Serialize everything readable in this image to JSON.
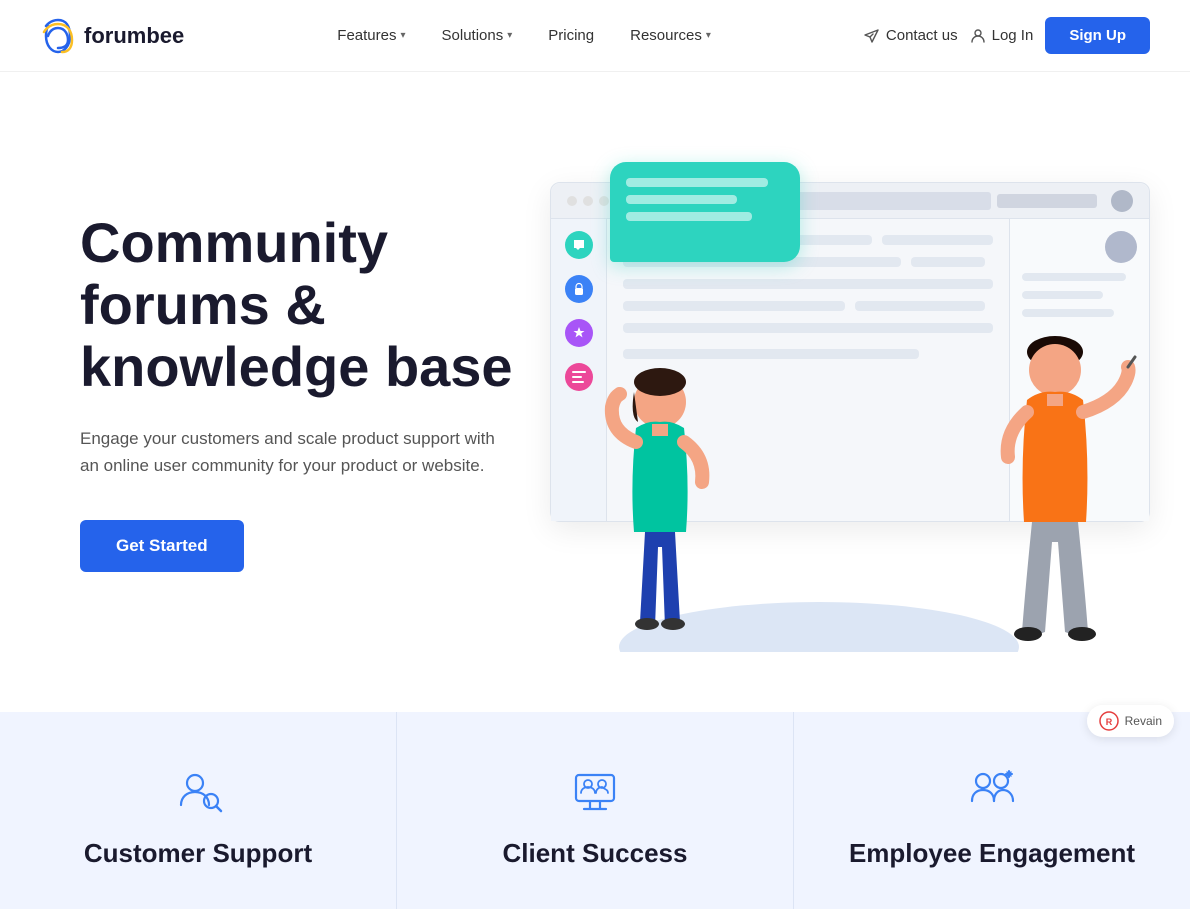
{
  "nav": {
    "logo_text": "forumbee",
    "links": [
      {
        "label": "Features",
        "has_dropdown": true
      },
      {
        "label": "Solutions",
        "has_dropdown": true
      },
      {
        "label": "Pricing",
        "has_dropdown": false
      },
      {
        "label": "Resources",
        "has_dropdown": true
      }
    ],
    "contact_label": "Contact us",
    "login_label": "Log In",
    "signup_label": "Sign Up"
  },
  "hero": {
    "title_line1": "Community forums &",
    "title_line2": "knowledge base",
    "subtitle": "Engage your customers and scale product support with an online user community for your product or website.",
    "cta_label": "Get Started"
  },
  "cards": [
    {
      "id": "customer-support",
      "title": "Customer Support",
      "icon": "customer-support-icon"
    },
    {
      "id": "client-success",
      "title": "Client Success",
      "icon": "client-success-icon"
    },
    {
      "id": "employee-engagement",
      "title": "Employee Engagement",
      "icon": "employee-engagement-icon"
    }
  ],
  "browser": {
    "rows": [
      {
        "color": "#2dd4bf"
      },
      {
        "color": "#3b82f6"
      },
      {
        "color": "#a855f7"
      },
      {
        "color": "#ec4899"
      }
    ]
  },
  "sidebar_icons": [
    {
      "color": "#2dd4bf",
      "symbol": "💬"
    },
    {
      "color": "#3b82f6",
      "symbol": "🔒"
    },
    {
      "color": "#a855f7",
      "symbol": "⭐"
    },
    {
      "color": "#ec4899",
      "symbol": "📋"
    }
  ]
}
